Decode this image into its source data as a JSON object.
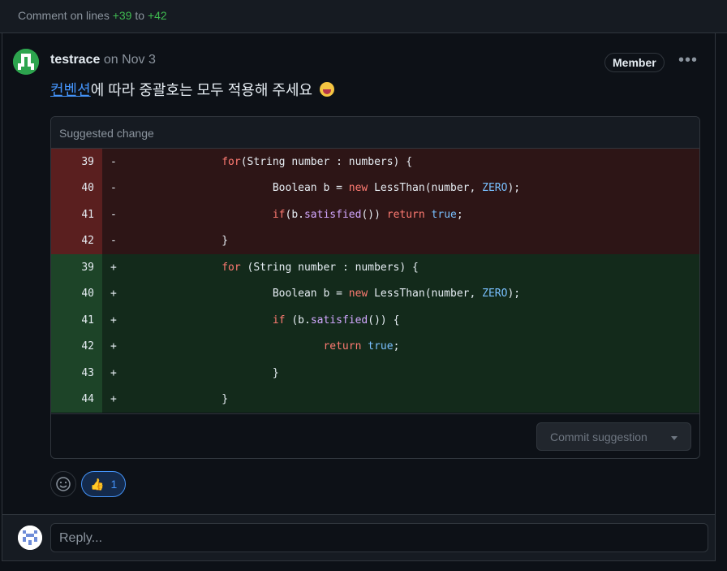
{
  "header": {
    "prefix": "Comment on lines",
    "from": "+39",
    "to_word": "to",
    "to": "+42"
  },
  "comment": {
    "author": "testrace",
    "date": "on Nov 3",
    "badge": "Member",
    "more_icon": "kebab-horizontal-icon",
    "body_link": "컨벤션",
    "body_text": "에 따라 중괄호는 모두 적용해 주세요",
    "emoji": "grinning-tongue-emoji"
  },
  "suggestion": {
    "title": "Suggested change",
    "removed": [
      {
        "num": "39",
        "sign": "-"
      },
      {
        "num": "40",
        "sign": "-"
      },
      {
        "num": "41",
        "sign": "-"
      },
      {
        "num": "42",
        "sign": "-"
      }
    ],
    "added": [
      {
        "num": "39",
        "sign": "+"
      },
      {
        "num": "40",
        "sign": "+"
      },
      {
        "num": "41",
        "sign": "+"
      },
      {
        "num": "42",
        "sign": "+"
      },
      {
        "num": "43",
        "sign": "+"
      },
      {
        "num": "44",
        "sign": "+"
      }
    ],
    "commit_button": "Commit suggestion"
  },
  "reactions": {
    "add_icon": "smiley-icon",
    "thumbs_count": "1"
  },
  "reply": {
    "placeholder": "Reply..."
  },
  "colors": {
    "accent": "#4493f8",
    "added": "#3fb950",
    "removed_bg": "#2d1516",
    "added_bg": "#132a1b"
  }
}
